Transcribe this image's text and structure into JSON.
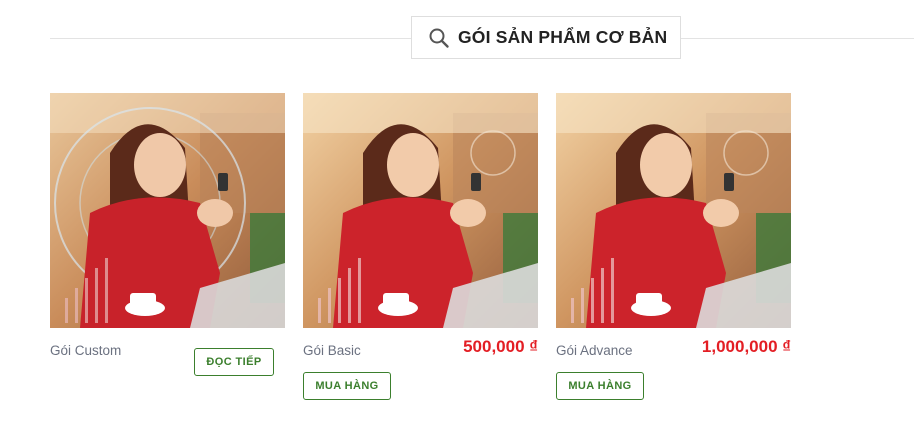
{
  "section": {
    "title": "GÓI SẢN PHẨM CƠ BẢN",
    "icon": "search-icon"
  },
  "colors": {
    "price": "#e31e24",
    "button_border": "#3b7f2d",
    "name_text": "#6b7180"
  },
  "products": [
    {
      "name": "Gói Custom",
      "price": "",
      "button": "ĐỌC TIẾP"
    },
    {
      "name": "Gói Basic",
      "price": "500,000 ₫",
      "button": "MUA HÀNG"
    },
    {
      "name": "Gói Advance",
      "price": "1,000,000 ₫",
      "button": "MUA HÀNG"
    }
  ]
}
